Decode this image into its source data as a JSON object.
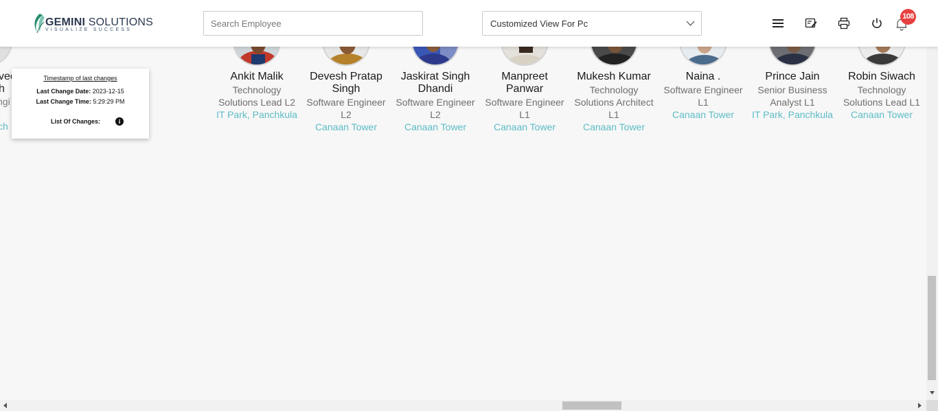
{
  "header": {
    "logo": {
      "name_bold": "GEMINI",
      "name_light": " SOLUTIONS",
      "tagline": "VISUALIZE SUCCESS"
    },
    "search": {
      "placeholder": "Search Employee",
      "value": ""
    },
    "view_select": {
      "selected": "Customized View For Pc"
    },
    "icons": [
      "menu-icon",
      "edit-note-icon",
      "printer-icon",
      "power-icon",
      "bell-icon"
    ],
    "notification_count": "108"
  },
  "partial_left_card": {
    "name_fragment_1": "vee",
    "name_fragment_2": "h",
    "role_fragment": "ngi",
    "loc_fragment": "ch"
  },
  "employees": [
    {
      "name": "Ankit Malik",
      "role": [
        "Technology",
        "Solutions Lead L2"
      ],
      "location": "IT Park, Panchkula"
    },
    {
      "name": "Devesh Pratap Singh",
      "name_lines": [
        "Devesh Pratap",
        "Singh"
      ],
      "role": [
        "Software Engineer",
        "L2"
      ],
      "location": "Canaan Tower"
    },
    {
      "name": "Jaskirat Singh Dhandi",
      "name_lines": [
        "Jaskirat Singh",
        "Dhandi"
      ],
      "role": [
        "Software Engineer",
        "L2"
      ],
      "location": "Canaan Tower"
    },
    {
      "name": "Manpreet Panwar",
      "name_lines": [
        "Manpreet",
        "Panwar"
      ],
      "role": [
        "Software Engineer",
        "L1"
      ],
      "location": "Canaan Tower"
    },
    {
      "name": "Mukesh Kumar",
      "role": [
        "Technology",
        "Solutions Architect",
        "L1"
      ],
      "location": "Canaan Tower"
    },
    {
      "name": "Naina .",
      "role": [
        "Software Engineer",
        "L1"
      ],
      "location": "Canaan Tower"
    },
    {
      "name": "Prince Jain",
      "role": [
        "Senior Business",
        "Analyst L1"
      ],
      "location": "IT Park, Panchkula"
    },
    {
      "name": "Robin Siwach",
      "role": [
        "Technology",
        "Solutions Lead L1"
      ],
      "location": "Canaan Tower"
    }
  ],
  "timestamp_popup": {
    "title": "Timestamp of last changes",
    "date_label": "Last Change Date:",
    "date_value": "2023-12-15",
    "time_label": "Last Change Time:",
    "time_value": "5:29:29 PM",
    "changes_label": "List Of Changes:",
    "info_glyph": "i"
  },
  "colors": {
    "location": "#5cbcc5",
    "badge": "#e84040",
    "header_bg": "#ffffff",
    "page_bg": "#f7f7f7"
  }
}
